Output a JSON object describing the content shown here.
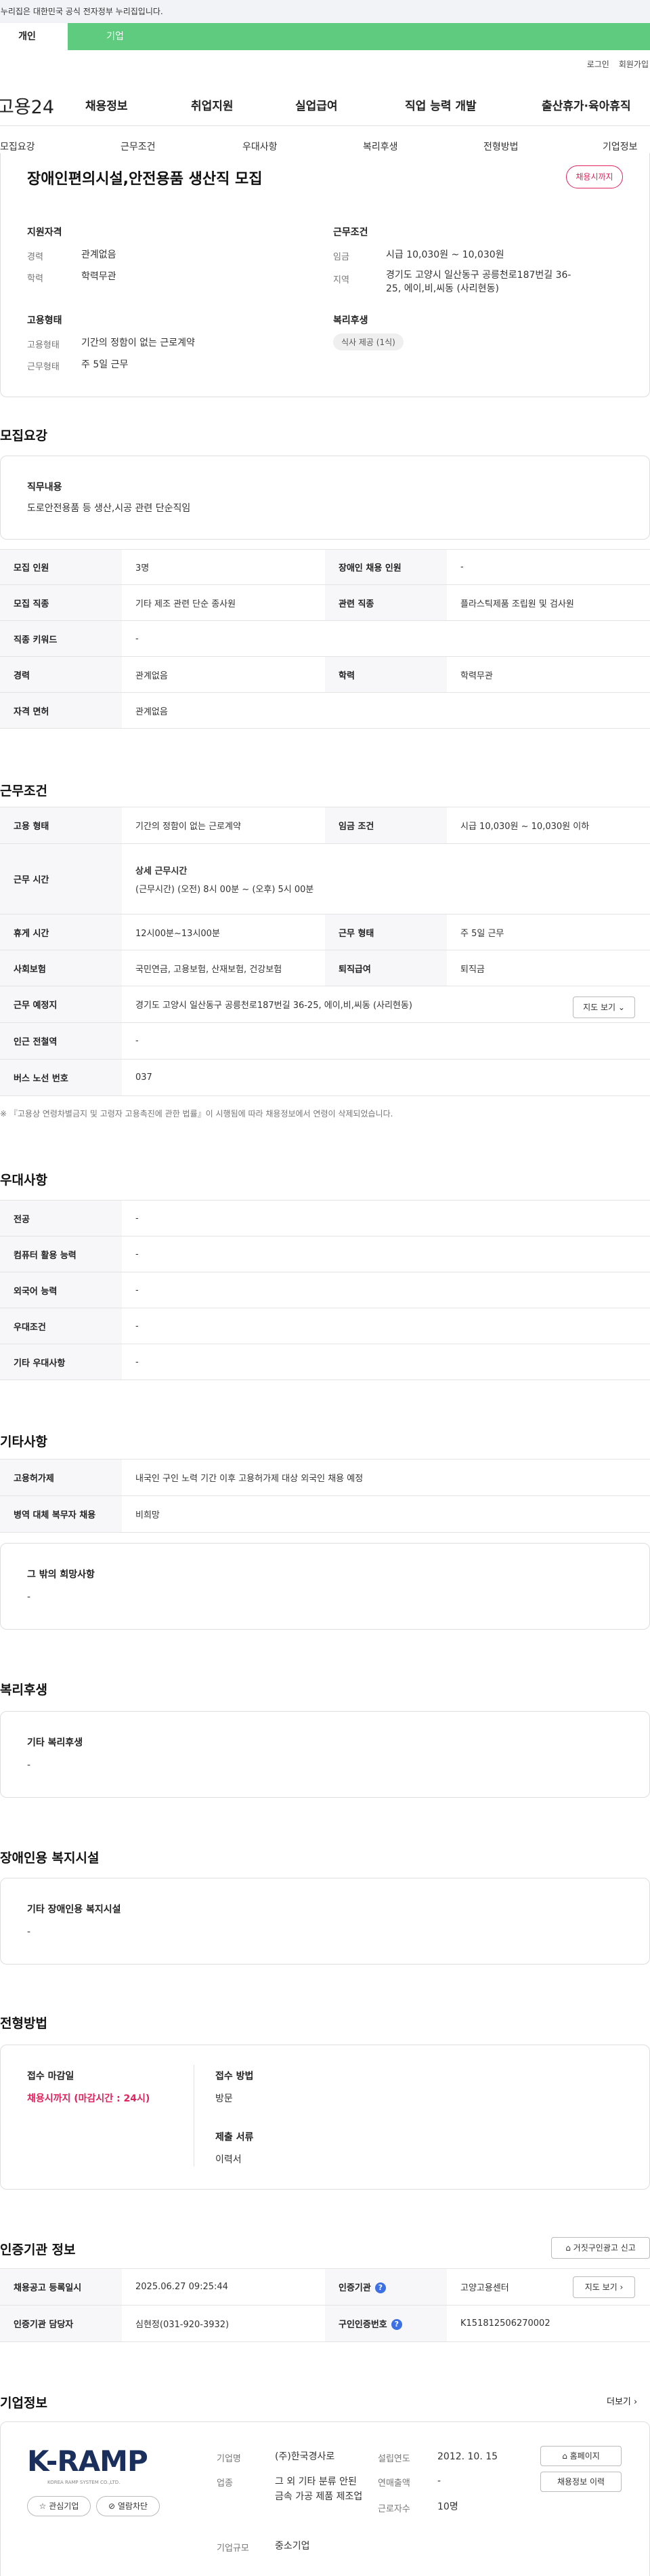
{
  "gov_banner": "이 누리집은 대한민국 공식 전자정부 누리집입니다.",
  "top_tabs": [
    "개인",
    "기업"
  ],
  "utility": {
    "login": "로그인",
    "signup": "회원가입"
  },
  "logo": "고용24",
  "main_menu": [
    "채용정보",
    "취업지원",
    "실업급여",
    "직업 능력 개발",
    "출산휴가·육아휴직"
  ],
  "sub_nav": [
    "모집요강",
    "근무조건",
    "우대사항",
    "복리후생",
    "전형방법",
    "기업정보"
  ],
  "job_title": "장애인편의시설,안전용품 생산직 모집",
  "status_chip": "채용시까지",
  "summary": {
    "qualification": {
      "heading": "지원자격",
      "items": [
        {
          "label": "경력",
          "value": "관계없음"
        },
        {
          "label": "학력",
          "value": "학력무관"
        }
      ]
    },
    "conditions": {
      "heading": "근무조건",
      "items": [
        {
          "label": "임금",
          "value": "시급 10,030원 ~ 10,030원"
        },
        {
          "label": "지역",
          "value": "경기도 고양시 일산동구 공릉천로187번길 36-25, 에이,비,씨동 (사리현동)"
        }
      ]
    },
    "employment": {
      "heading": "고용형태",
      "items": [
        {
          "label": "고용형태",
          "value": "기간의 정함이 없는 근로계약"
        },
        {
          "label": "근무형태",
          "value": "주 5일 근무"
        }
      ]
    },
    "welfare": {
      "heading": "복리후생",
      "pill": "식사 제공 (1식)"
    }
  },
  "recruit": {
    "heading": "모집요강",
    "duty_label": "직무내용",
    "duty_value": "도로안전용품 등 생산,시공 관련 단순직임",
    "table": {
      "headcount_label": "모집 인원",
      "headcount": "3명",
      "disabled_label": "장애인 채용 인원",
      "disabled": "-",
      "job_label": "모집 직종",
      "job": "기타 제조 관련 단순 종사원",
      "related_label": "관련 직종",
      "related": "플라스틱제품 조립원 및 검사원",
      "keyword_label": "직종 키워드",
      "keyword": "-",
      "career_label": "경력",
      "career": "관계없음",
      "edu_label": "학력",
      "edu": "학력무관",
      "license_label": "자격 면허",
      "license": "관계없음"
    }
  },
  "work": {
    "heading": "근무조건",
    "type_label": "고용 형태",
    "type": "기간의 정함이 없는 근로계약",
    "wage_label": "임금 조건",
    "wage": "시급 10,030원 ~ 10,030원 이하",
    "hours_label": "근무 시간",
    "hours_title": "상세 근무시간",
    "hours": "(근무시간) (오전) 8시 00분 ~ (오후) 5시 00분",
    "break_label": "휴게 시간",
    "break": "12시00분~13시00분",
    "form_label": "근무 형태",
    "form": "주 5일 근무",
    "insurance_label": "사회보험",
    "insurance": "국민연금, 고용보험, 산재보험, 건강보험",
    "severance_label": "퇴직급여",
    "severance": "퇴직금",
    "place_label": "근무 예정지",
    "place": "경기도 고양시 일산동구 공릉천로187번길 36-25, 에이,비,씨동 (사리현동)",
    "map_btn": "지도 보기",
    "subway_label": "인근 전철역",
    "subway": "-",
    "bus_label": "버스 노선 번호",
    "bus": "037",
    "note": "※ 『고용상 연령차별금지 및 고령자 고용촉진에 관한 법률』이 시행됨에 따라 채용정보에서 연령이 삭제되었습니다."
  },
  "preference": {
    "heading": "우대사항",
    "rows": [
      {
        "label": "전공",
        "value": "-"
      },
      {
        "label": "컴퓨터 활용 능력",
        "value": "-"
      },
      {
        "label": "외국어 능력",
        "value": "-"
      },
      {
        "label": "우대조건",
        "value": "-"
      },
      {
        "label": "기타 우대사항",
        "value": "-"
      }
    ]
  },
  "etc": {
    "heading": "기타사항",
    "rows": [
      {
        "label": "고용허가제",
        "value": "내국인 구인 노력 기간 이후 고용허가제 대상 외국인 채용 예정"
      },
      {
        "label": "병역 대체 복무자 채용",
        "value": "비희망"
      }
    ],
    "box_label": "그 밖의 희망사항",
    "box_value": "-"
  },
  "benefit": {
    "heading": "복리후생",
    "box_label": "기타 복리후생",
    "box_value": "-"
  },
  "disabled_facility": {
    "heading": "장애인용 복지시설",
    "box_label": "기타 장애인용 복지시설",
    "box_value": "-"
  },
  "selection": {
    "heading": "전형방법",
    "deadline_label": "접수 마감일",
    "deadline": "채용시까지 (마감시간 : 24시)",
    "method_label": "접수 방법",
    "method": "방문",
    "docs_label": "제출 서류",
    "docs": "이력서"
  },
  "cert": {
    "heading": "인증기관 정보",
    "report_btn": "거짓구인광고 신고",
    "reg_label": "채용공고 등록일시",
    "reg": "2025.06.27 09:25:44",
    "agency_label": "인증기관",
    "agency": "고양고용센터",
    "map_btn": "지도 보기",
    "manager_label": "인증기관 담당자",
    "manager": "심현정(031-920-3932)",
    "no_label": "구인인증번호",
    "no": "K151812506270002"
  },
  "company": {
    "heading": "기업정보",
    "more": "더보기",
    "logo_text": "K-RAMP",
    "logo_sub": "KOREA RAMP SYSTEM CO.,LTD.",
    "interest_btn": "관심기업",
    "block_btn": "열람차단",
    "name_label": "기업명",
    "name": "(주)한국경사로",
    "industry_label": "업종",
    "industry": "그 외 기타 분류 안된 금속 가공 제품 제조업",
    "size_label": "기업규모",
    "size": "중소기업",
    "founded_label": "설립연도",
    "founded": "2012. 10. 15",
    "sales_label": "연매출액",
    "sales": "-",
    "staff_label": "근로자수",
    "staff": "10명",
    "homepage_btn": "홈페이지",
    "history_btn": "채용정보 이력"
  }
}
